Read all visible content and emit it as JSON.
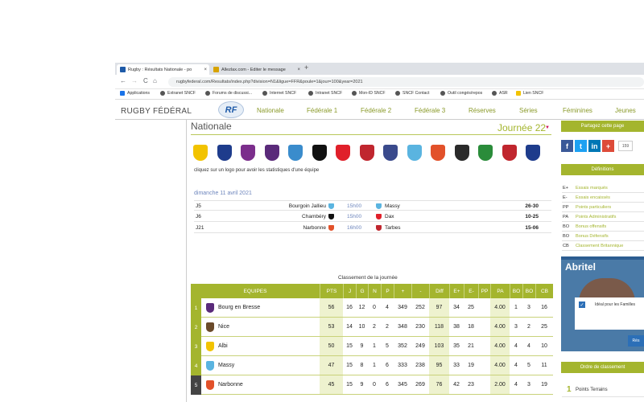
{
  "browser": {
    "tabs": [
      {
        "title": "Rugby : Résultats Nationale - po",
        "fav_color": "#1e5aa8",
        "active": true
      },
      {
        "title": "Allezlax.com - Editer le message",
        "fav_color": "#d7a300",
        "active": false
      }
    ],
    "new_tab": "+",
    "close": "×",
    "nav": {
      "back": "←",
      "forward": "→",
      "reload": "C",
      "home": "⌂"
    },
    "url": "rugbyfederal.com/Resultats/index.php?division=N1&ligue=FFR&poule=1&jour=100&year=2021",
    "bookmarks": [
      "Applications",
      "Extranet SNCF",
      "Forums de discussi...",
      "Internet SNCF",
      "Intranet SNCF",
      "Mon-ID SNCF",
      "SNCF Contact",
      "Outil congés/repos",
      "ASR",
      "Lien SNCF"
    ]
  },
  "site": {
    "brand": "RUGBY FÉDÉRAL",
    "logo_text": "RF",
    "nav": [
      "Nationale",
      "Fédérale 1",
      "Fédérale 2",
      "Fédérale 3",
      "Réserves",
      "Séries",
      "Féminines",
      "Jeunes"
    ]
  },
  "page": {
    "title": "Nationale",
    "journee": "Journée 22",
    "journee_arrow": "▼",
    "logo_colors": [
      "#f2c300",
      "#1e3c8c",
      "#7b2e8c",
      "#5a2a7a",
      "#3a8ccc",
      "#111111",
      "#e0202a",
      "#c0262e",
      "#3a4a8c",
      "#5ab4e0",
      "#e2512a",
      "#2a2a2a",
      "#2a8c3a",
      "#c0262e",
      "#1e3c8c"
    ],
    "hint": "cliquez sur un logo pour avoir les statistiques d'une équipe",
    "match_date": "dimanche 11 avril 2021",
    "matches": [
      {
        "j": "J5",
        "home": "Bourgoin Jallieu",
        "home_color": "#5ab4e0",
        "time": "15h00",
        "away": "Massy",
        "away_color": "#5ab4e0",
        "score": "26-30"
      },
      {
        "j": "J6",
        "home": "Chambéry",
        "home_color": "#111111",
        "time": "15h00",
        "away": "Dax",
        "away_color": "#e0202a",
        "score": "10-25"
      },
      {
        "j": "J21",
        "home": "Narbonne",
        "home_color": "#e2512a",
        "time": "16h00",
        "away": "Tarbes",
        "away_color": "#c0262e",
        "score": "15-06"
      }
    ],
    "classement_title": "Classement de la journée"
  },
  "standings": {
    "header": [
      "EQUIPES",
      "PTS",
      "J",
      "G",
      "N",
      "P",
      "+",
      "-",
      "Diff",
      "E+",
      "E-",
      "PP",
      "PA",
      "BO",
      "BO",
      "CB"
    ],
    "rows": [
      {
        "rank": "1",
        "team": "Bourg en Bresse",
        "color": "#5a2a7a",
        "cells": [
          "56",
          "16",
          "12",
          "0",
          "4",
          "349",
          "252",
          "97",
          "34",
          "25",
          "",
          "4.00",
          "1",
          "3",
          "16"
        ]
      },
      {
        "rank": "2",
        "team": "Nice",
        "color": "#6a4a2a",
        "cells": [
          "53",
          "14",
          "10",
          "2",
          "2",
          "348",
          "230",
          "118",
          "38",
          "18",
          "",
          "4.00",
          "3",
          "2",
          "25"
        ]
      },
      {
        "rank": "3",
        "team": "Albi",
        "color": "#f2c300",
        "cells": [
          "50",
          "15",
          "9",
          "1",
          "5",
          "352",
          "249",
          "103",
          "35",
          "21",
          "",
          "4.00",
          "4",
          "4",
          "10"
        ]
      },
      {
        "rank": "4",
        "team": "Massy",
        "color": "#5ab4e0",
        "cells": [
          "47",
          "15",
          "8",
          "1",
          "6",
          "333",
          "238",
          "95",
          "33",
          "19",
          "",
          "4.00",
          "4",
          "5",
          "11"
        ]
      },
      {
        "rank": "5",
        "team": "Narbonne",
        "color": "#e2512a",
        "cells": [
          "45",
          "15",
          "9",
          "0",
          "6",
          "345",
          "269",
          "76",
          "42",
          "23",
          "",
          "2.00",
          "4",
          "3",
          "19"
        ]
      }
    ]
  },
  "sidebar": {
    "share_title": "Partagez cette page",
    "share_buttons": [
      {
        "label": "f",
        "color": "#3b5998"
      },
      {
        "label": "t",
        "color": "#1da1f2"
      },
      {
        "label": "in",
        "color": "#0077b5"
      },
      {
        "label": "+",
        "color": "#dd4b39"
      }
    ],
    "share_count": "159",
    "definitions_title": "Définitions",
    "definitions": [
      {
        "abbr": "E+",
        "text": "Essais marqués"
      },
      {
        "abbr": "E-",
        "text": "Essais encaissés"
      },
      {
        "abbr": "PP",
        "text": "Points particuliers"
      },
      {
        "abbr": "PA",
        "text": "Points Administratifs"
      },
      {
        "abbr": "BO",
        "text": "Bonus offensifs"
      },
      {
        "abbr": "BO",
        "text": "Bonus Défensifs"
      },
      {
        "abbr": "CB",
        "text": "Classement Britannique"
      }
    ],
    "ad": {
      "title": "Abritel",
      "text": "Idéal pour les Familles",
      "button": "Rés",
      "check": "✓"
    },
    "ordre_title": "Ordre de classement",
    "ordre_rank": "1",
    "ordre_text": "Points Terrains"
  }
}
